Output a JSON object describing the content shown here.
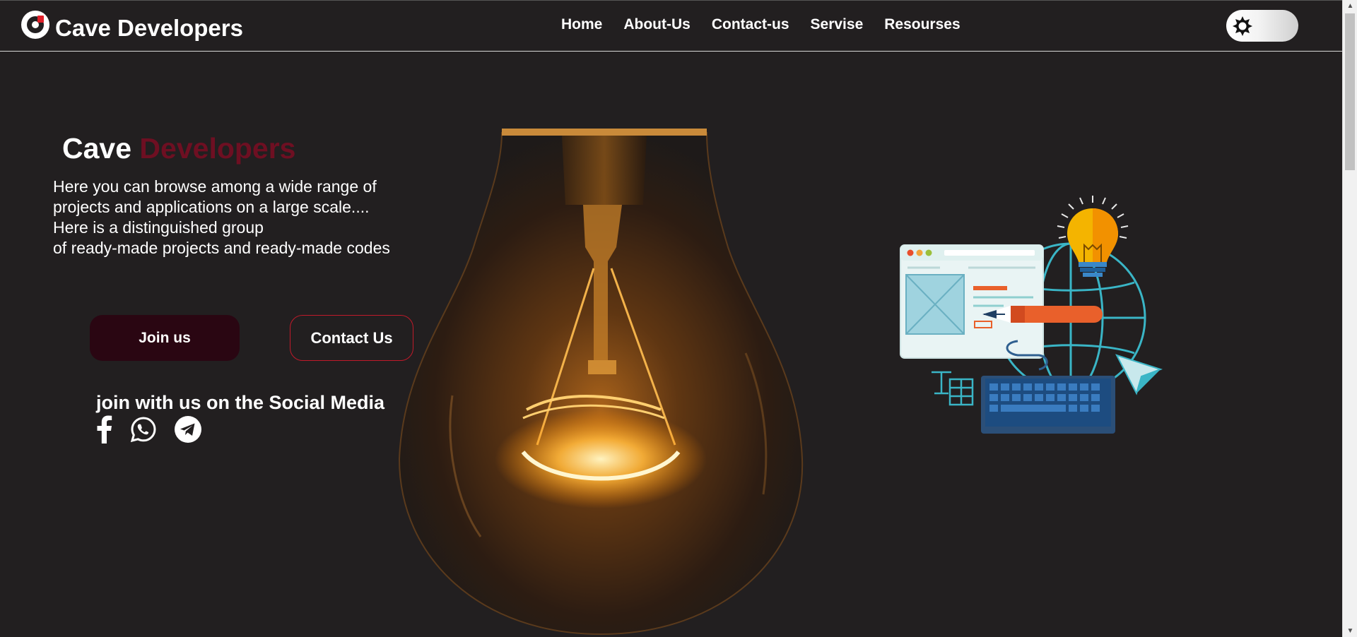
{
  "header": {
    "brand": "Cave Developers",
    "nav": [
      "Home",
      "About-Us",
      "Contact-us",
      "Servise",
      "Resourses"
    ]
  },
  "hero": {
    "title_part1": "Cave",
    "title_part2": "Developers",
    "description_lines": [
      "Here you can browse among a wide range of",
      "projects and applications on a large scale....",
      "Here is a distinguished group",
      "of ready-made projects and ready-made codes"
    ],
    "join_label": "Join us",
    "contact_label": "Contact Us",
    "social_title": "join with us on the Social Media"
  },
  "icons": {
    "logo": "logo-icon",
    "theme_toggle": "sun-icon",
    "social": [
      "facebook-icon",
      "whatsapp-icon",
      "telegram-icon"
    ]
  },
  "colors": {
    "background": "#221f20",
    "accent": "#6e0f22",
    "join_button": "#2a0612",
    "contact_border": "#c01a2a"
  }
}
